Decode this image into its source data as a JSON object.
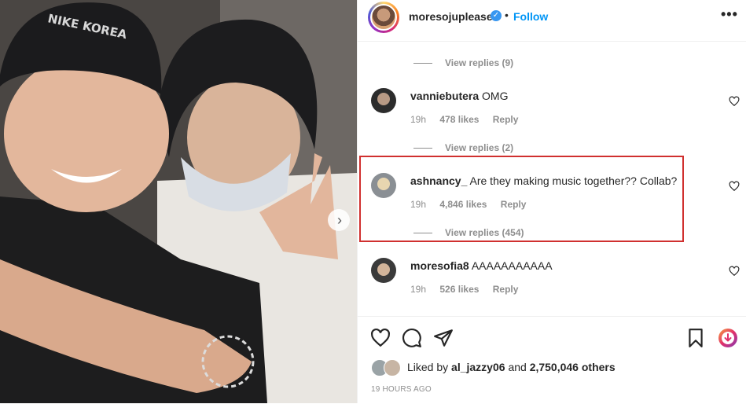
{
  "header": {
    "username": "moresojuplease",
    "verified_icon": "verified-badge-icon",
    "separator": "•",
    "follow_label": "Follow",
    "more_label": "•••"
  },
  "photo": {
    "cap_text": "NIKE KOREA"
  },
  "comments": {
    "top_replies": "View replies (9)",
    "items": [
      {
        "user": "vanniebutera",
        "text": "OMG",
        "time": "19h",
        "likes": "478 likes",
        "reply": "Reply",
        "replies": "View replies (2)"
      },
      {
        "user": "ashnancy_",
        "text": "Are they making music together?? Collab?",
        "time": "19h",
        "likes": "4,846 likes",
        "reply": "Reply",
        "replies": "View replies (454)"
      },
      {
        "user": "moresofia8",
        "text": "AAAAAAAAAAA",
        "time": "19h",
        "likes": "526 likes",
        "reply": "Reply"
      }
    ]
  },
  "footer": {
    "liked_prefix": "Liked by",
    "liked_user": "al_jazzy06",
    "liked_and": "and",
    "liked_others": "2,750,046 others",
    "timestamp": "19 HOURS AGO"
  },
  "colors": {
    "accent": "#0095f6",
    "highlight": "#d0302f",
    "muted": "#8e8e8e"
  }
}
